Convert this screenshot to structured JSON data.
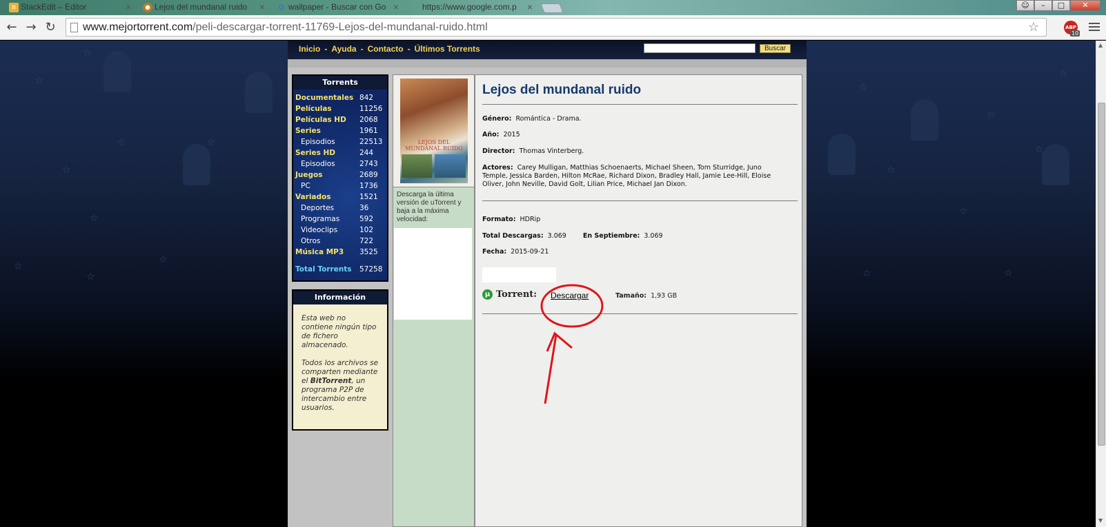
{
  "browser": {
    "tabs": [
      {
        "label": "StackEdit – Editor",
        "favicon": "stackedit-icon",
        "active": false
      },
      {
        "label": "Lejos del mundanal ruido",
        "favicon": "site-icon",
        "active": true
      },
      {
        "label": "wallpaper - Buscar con Go",
        "favicon": "google-icon",
        "active": false
      },
      {
        "label": "https://www.google.com.p",
        "favicon": "blank-icon",
        "active": false
      }
    ],
    "url_domain": "www.mejortorrent.com",
    "url_path": "/peli-descargar-torrent-11769-Lejos-del-mundanal-ruido.html",
    "abp_label": "ABP",
    "abp_count": "10"
  },
  "site": {
    "nav": [
      {
        "label": "Inicio"
      },
      {
        "label": "Ayuda"
      },
      {
        "label": "Contacto"
      },
      {
        "label": "Últimos Torrents"
      }
    ],
    "nav_separator": "-",
    "search_button": "Buscar",
    "sidebar": {
      "torrents_title": "Torrents",
      "categories": [
        {
          "name": "Documentales",
          "count": "842",
          "sub": false
        },
        {
          "name": "Películas",
          "count": "11256",
          "sub": false
        },
        {
          "name": "Películas HD",
          "count": "2068",
          "sub": false
        },
        {
          "name": "Series",
          "count": "1961",
          "sub": false
        },
        {
          "name": "Episodios",
          "count": "22513",
          "sub": true
        },
        {
          "name": "Series HD",
          "count": "244",
          "sub": false
        },
        {
          "name": "Episodios",
          "count": "2743",
          "sub": true
        },
        {
          "name": "Juegos",
          "count": "2689",
          "sub": false
        },
        {
          "name": "PC",
          "count": "1736",
          "sub": true
        },
        {
          "name": "Variados",
          "count": "1521",
          "sub": false
        },
        {
          "name": "Deportes",
          "count": "36",
          "sub": true
        },
        {
          "name": "Programas",
          "count": "592",
          "sub": true
        },
        {
          "name": "Videoclips",
          "count": "102",
          "sub": true
        },
        {
          "name": "Otros",
          "count": "722",
          "sub": true
        },
        {
          "name": "Música MP3",
          "count": "3525",
          "sub": false
        }
      ],
      "total_label": "Total Torrents",
      "total_count": "57258",
      "info_title": "Información",
      "info_p1": "Esta web no contiene ningún tipo de fichero almacenado.",
      "info_p2_pre": "Todos los archivos se comparten mediante el ",
      "info_p2_bold": "BitTorrent",
      "info_p2_post": ", un programa P2P de intercambio entre usuarios."
    },
    "poster_title": "LEJOS DEL MUNDANAL RUIDO",
    "utorrent_text": "Descarga la última versión de uTorrent y baja a la máxima velocidad:",
    "movie": {
      "title": "Lejos del mundanal ruido",
      "genero_label": "Género:",
      "genero": "Romántica - Drama.",
      "anio_label": "Año:",
      "anio": "2015",
      "director_label": "Director:",
      "director": "Thomas Vinterberg.",
      "actores_label": "Actores:",
      "actores": "Carey Mulligan, Matthias Schoenaerts, Michael Sheen, Tom Sturridge, Juno Temple, Jessica Barden, Hilton McRae, Richard Dixon, Bradley Hall, Jamie Lee-Hill, Eloise Oliver, John Neville, David Golt, Lilian Price, Michael Jan Dixon.",
      "formato_label": "Formato:",
      "formato": "HDRip",
      "descargas_label": "Total Descargas:",
      "descargas": "3.069",
      "septiembre_label": "En Septiembre:",
      "septiembre": "3.069",
      "fecha_label": "Fecha:",
      "fecha": "2015-09-21",
      "torrent_label": "Torrent:",
      "descargar": "Descargar",
      "tamano_label": "Tamaño:",
      "tamano": "1,93 GB"
    }
  },
  "colors": {
    "nav_text": "#f2d35a",
    "title_blue": "#173a6e",
    "annotation_red": "#e0141a"
  }
}
